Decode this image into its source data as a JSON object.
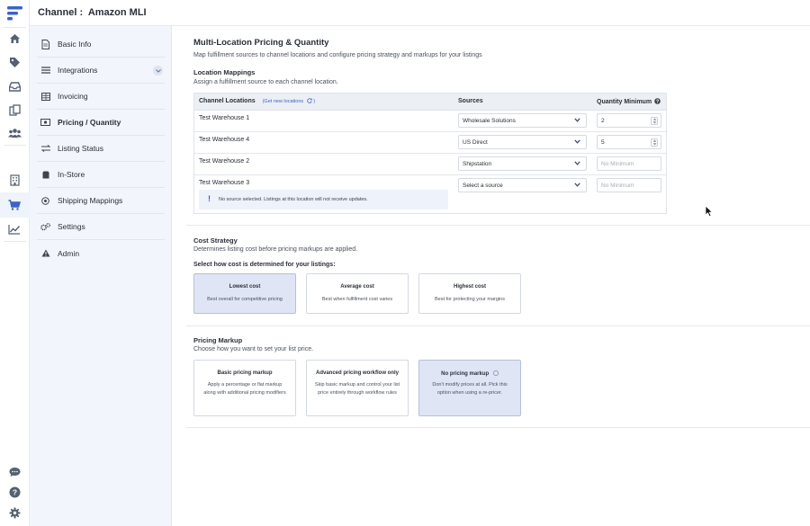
{
  "header": {
    "title": "Channel :  Amazon MLI"
  },
  "rail": {
    "icons": [
      "home-icon",
      "tag-icon",
      "inbox-icon",
      "copy-icon",
      "users-icon",
      "building-icon",
      "cart-icon",
      "chart-icon",
      "chat-icon",
      "help-icon",
      "gear-icon"
    ]
  },
  "sidenav": {
    "items": [
      {
        "label": "Basic Info",
        "icon": "document-icon"
      },
      {
        "label": "Integrations",
        "icon": "list-icon"
      },
      {
        "label": "Invoicing",
        "icon": "table-icon"
      },
      {
        "label": "Pricing / Quantity",
        "icon": "money-icon"
      },
      {
        "label": "Listing Status",
        "icon": "arrows-icon"
      },
      {
        "label": "In-Store",
        "icon": "store-icon"
      },
      {
        "label": "Shipping Mappings",
        "icon": "target-icon"
      },
      {
        "label": "Settings",
        "icon": "cogs-icon"
      },
      {
        "label": "Admin",
        "icon": "alert-icon"
      }
    ],
    "active": "Pricing / Quantity"
  },
  "main": {
    "title": "Multi-Location Pricing & Quantity",
    "subtitle": "Map fulfillment sources to channel locations and configure pricing strategy and markups for your listings",
    "location_mappings": {
      "heading": "Location Mappings",
      "description": "Assign a fulfillment source to each channel location.",
      "columns": {
        "locations": "Channel Locations",
        "get_new": "Get new locations",
        "sources": "Sources",
        "qty_min": "Quantity Minimum"
      },
      "rows": [
        {
          "location": "Test Warehouse 1",
          "source": "Wholesale Solutions",
          "qty": "2"
        },
        {
          "location": "Test Warehouse 4",
          "source": "US Direct",
          "qty": "5"
        },
        {
          "location": "Test Warehouse 2",
          "source": "Shipstation",
          "qty": "No Minimum"
        },
        {
          "location": "Test Warehouse 3",
          "source": "Select a source",
          "qty": "No Minimum"
        }
      ],
      "warning": "No source selected. Listings at this location will not receive updates."
    },
    "cost_strategy": {
      "heading": "Cost Strategy",
      "description": "Determines listing cost before pricing markups are applied.",
      "prompt": "Select how cost is determined for your listings:",
      "options": [
        {
          "title": "Lowest cost",
          "desc": "Best overall for competitive pricing",
          "selected": true
        },
        {
          "title": "Average cost",
          "desc": "Best when fulfillment cost varies",
          "selected": false
        },
        {
          "title": "Highest cost",
          "desc": "Best for protecting your margins",
          "selected": false
        }
      ]
    },
    "pricing_markup": {
      "heading": "Pricing Markup",
      "description": "Choose how you want to set your list price.",
      "options": [
        {
          "title": "Basic pricing markup",
          "desc": "Apply a percentage or flat markup along with additional pricing modifiers",
          "selected": false
        },
        {
          "title": "Advanced pricing workflow only",
          "desc": "Skip basic markup and control your list price entirely through workflow rules",
          "selected": false
        },
        {
          "title": "No pricing markup",
          "desc": "Don't modify prices at all. Pick this option when using a re-pricer.",
          "selected": true
        }
      ]
    }
  },
  "colors": {
    "accent": "#3b63c6",
    "selected_card": "#dfe5f5",
    "sidenav_bg": "#f2f5fb"
  }
}
